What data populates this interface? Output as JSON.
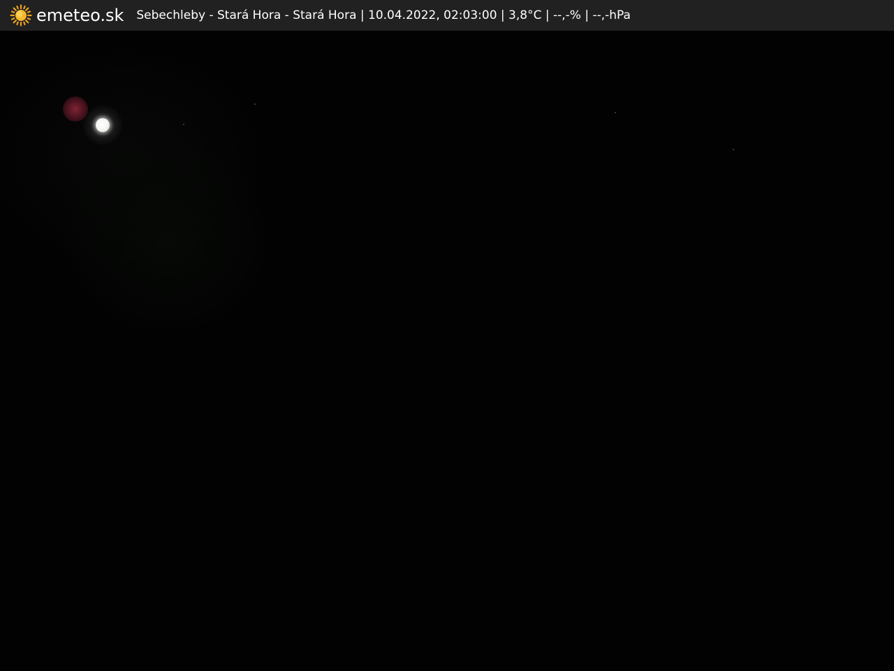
{
  "header": {
    "logo_icon": "sun-icon",
    "brand": "emeteo.sk",
    "caption": "Sebechleby - Stará Hora - Stará Hora | 10.04.2022, 02:03:00 | 3,8°C | --,-% | --,-hPa"
  },
  "colors": {
    "topbar_background": "#212121",
    "text": "#ffffff",
    "sun_core": "#f5b82e",
    "sun_rays": "#f0a21c",
    "scene_background": "#000000"
  }
}
